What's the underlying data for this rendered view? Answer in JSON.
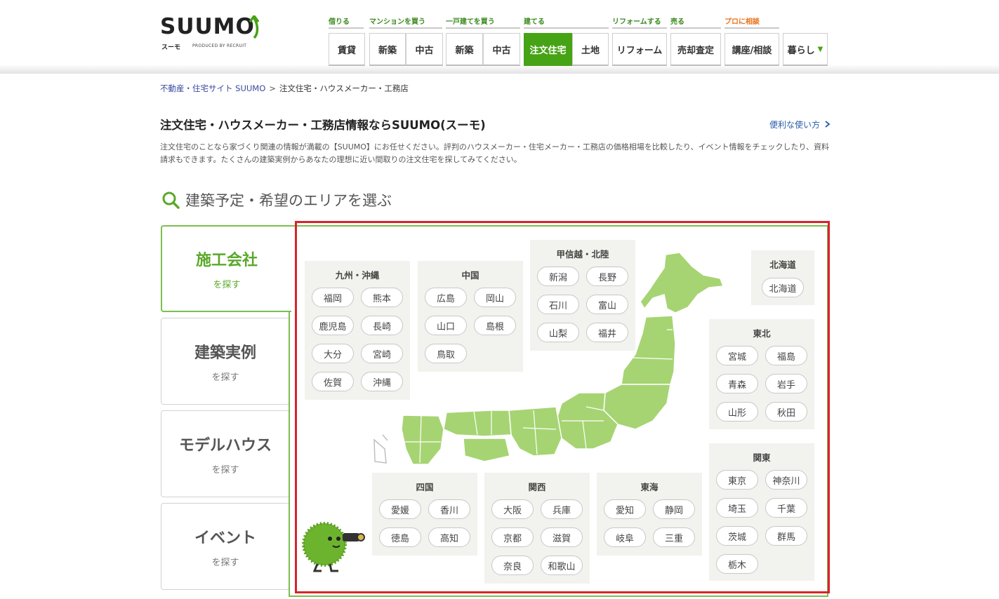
{
  "header": {
    "logo_text": "SUUMO",
    "logo_kana": "スーモ",
    "logo_produced": "PRODUCED BY RECRUIT",
    "categories": [
      {
        "label": "借りる"
      },
      {
        "label": "マンションを買う"
      },
      {
        "label": "一戸建てを買う"
      },
      {
        "label": "建てる"
      },
      {
        "label": "リフォームする"
      },
      {
        "label": "売る"
      },
      {
        "label": "プロに相談"
      }
    ],
    "buttons": [
      {
        "label": "賃貸"
      },
      {
        "label": "新築"
      },
      {
        "label": "中古"
      },
      {
        "label": "新築"
      },
      {
        "label": "中古"
      },
      {
        "label": "注文住宅"
      },
      {
        "label": "土地"
      },
      {
        "label": "リフォーム"
      },
      {
        "label": "売却査定"
      },
      {
        "label": "講座/相談"
      },
      {
        "label": "暮らし"
      }
    ],
    "accent_color": "#46a315",
    "pro_color": "#e8731a"
  },
  "breadcrumb": {
    "home": "不動産・住宅サイト SUUMO",
    "separator": ">",
    "current": "注文住宅・ハウスメーカー・工務店"
  },
  "page": {
    "title": "注文住宅・ハウスメーカー・工務店情報ならSUUMO(スーモ)",
    "help_link": "便利な使い方",
    "intro": "注文住宅のことなら家づくり関連の情報が満載の【SUUMO】にお任せください。評判のハウスメーカー・住宅メーカー・工務店の価格相場を比較したり、イベント情報をチェックしたり、資料請求もできます。たくさんの建築実例からあなたの理想に近い間取りの注文住宅を探してみてください。",
    "area_heading": "建築予定・希望のエリアを選ぶ"
  },
  "side_tabs": [
    {
      "title": "施工会社",
      "sub": "を探す"
    },
    {
      "title": "建築実例",
      "sub": "を探す"
    },
    {
      "title": "モデルハウス",
      "sub": "を探す"
    },
    {
      "title": "イベント",
      "sub": "を探す"
    }
  ],
  "regions": {
    "kyushu": {
      "name": "九州・沖縄",
      "prefs": [
        "福岡",
        "熊本",
        "鹿児島",
        "長崎",
        "大分",
        "宮崎",
        "佐賀",
        "沖縄"
      ]
    },
    "chugoku": {
      "name": "中国",
      "prefs": [
        "広島",
        "岡山",
        "山口",
        "島根",
        "鳥取"
      ]
    },
    "koshinetsu": {
      "name": "甲信越・北陸",
      "prefs": [
        "新潟",
        "長野",
        "石川",
        "富山",
        "山梨",
        "福井"
      ]
    },
    "hokkaido": {
      "name": "北海道",
      "prefs": [
        "北海道"
      ]
    },
    "tohoku": {
      "name": "東北",
      "prefs": [
        "宮城",
        "福島",
        "青森",
        "岩手",
        "山形",
        "秋田"
      ]
    },
    "kanto": {
      "name": "関東",
      "prefs": [
        "東京",
        "神奈川",
        "埼玉",
        "千葉",
        "茨城",
        "群馬",
        "栃木"
      ]
    },
    "shikoku": {
      "name": "四国",
      "prefs": [
        "愛媛",
        "香川",
        "徳島",
        "高知"
      ]
    },
    "kansai": {
      "name": "関西",
      "prefs": [
        "大阪",
        "兵庫",
        "京都",
        "滋賀",
        "奈良",
        "和歌山"
      ]
    },
    "tokai": {
      "name": "東海",
      "prefs": [
        "愛知",
        "静岡",
        "岐阜",
        "三重"
      ]
    }
  },
  "colors": {
    "map_fill": "#a6d472",
    "map_stroke": "#ffffff",
    "highlight_border": "#d9232a",
    "region_bg": "#f2f2ee"
  }
}
